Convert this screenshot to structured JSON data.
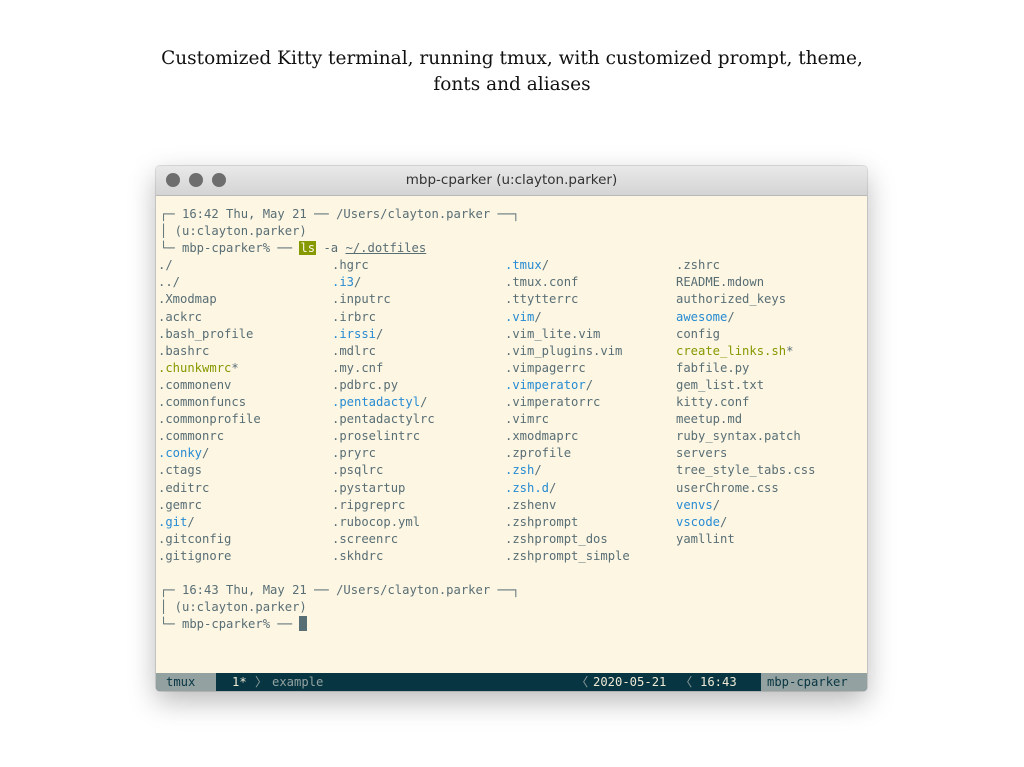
{
  "caption": {
    "line1": "Customized Kitty terminal, running tmux, with customized prompt, theme,",
    "line2": "fonts and aliases"
  },
  "window": {
    "title": "mbp-cparker (u:clayton.parker)",
    "traffic_lights": [
      "close",
      "minimize",
      "zoom"
    ]
  },
  "prompt1": {
    "top": "┌─ 16:42 Thu, May 21 ── /Users/clayton.parker ──┐",
    "user": "│ (u:clayton.parker)",
    "host": "└─ mbp-cparker% ── ",
    "cmd": "ls",
    "flag": "-a",
    "path": "~/.dotfiles"
  },
  "listing": {
    "col1": [
      "./",
      "../",
      ".Xmodmap",
      ".ackrc",
      ".bash_profile",
      ".bashrc",
      ".chunkwmrc*",
      ".commonenv",
      ".commonfuncs",
      ".commonprofile",
      ".commonrc",
      ".conky/",
      ".ctags",
      ".editrc",
      ".gemrc",
      ".git/",
      ".gitconfig",
      ".gitignore"
    ],
    "col2": [
      ".hgrc",
      ".i3/",
      ".inputrc",
      ".irbrc",
      ".irssi/",
      ".mdlrc",
      ".my.cnf",
      ".pdbrc.py",
      ".pentadactyl/",
      ".pentadactylrc",
      ".proselintrc",
      ".pryrc",
      ".psqlrc",
      ".pystartup",
      ".ripgreprc",
      ".rubocop.yml",
      ".screenrc",
      ".skhdrc"
    ],
    "col3": [
      ".tmux/",
      ".tmux.conf",
      ".ttytterrc",
      ".vim/",
      ".vim_lite.vim",
      ".vim_plugins.vim",
      ".vimpagerrc",
      ".vimperator/",
      ".vimperatorrc",
      ".vimrc",
      ".xmodmaprc",
      ".zprofile",
      ".zsh/",
      ".zsh.d/",
      ".zshenv",
      ".zshprompt",
      ".zshprompt_dos",
      ".zshprompt_simple"
    ],
    "col4": [
      ".zshrc",
      "README.mdown",
      "authorized_keys",
      "awesome/",
      "config",
      "create_links.sh*",
      "fabfile.py",
      "gem_list.txt",
      "kitty.conf",
      "meetup.md",
      "ruby_syntax.patch",
      "servers",
      "tree_style_tabs.css",
      "userChrome.css",
      "venvs/",
      "vscode/",
      "yamllint"
    ]
  },
  "prompt2": {
    "top": "┌─ 16:43 Thu, May 21 ── /Users/clayton.parker ──┐",
    "user": "│ (u:clayton.parker)",
    "host": "└─ mbp-cparker% ── "
  },
  "statusbar": {
    "session": "tmux",
    "window_index": "1*",
    "window_name": "example",
    "date": "2020-05-21",
    "time": "16:43",
    "host": "mbp-cparker"
  },
  "colors": {
    "background": "#fdf6e3",
    "text": "#586e75",
    "directory": "#268bd2",
    "executable": "#859900",
    "statusbar": "#073642"
  }
}
